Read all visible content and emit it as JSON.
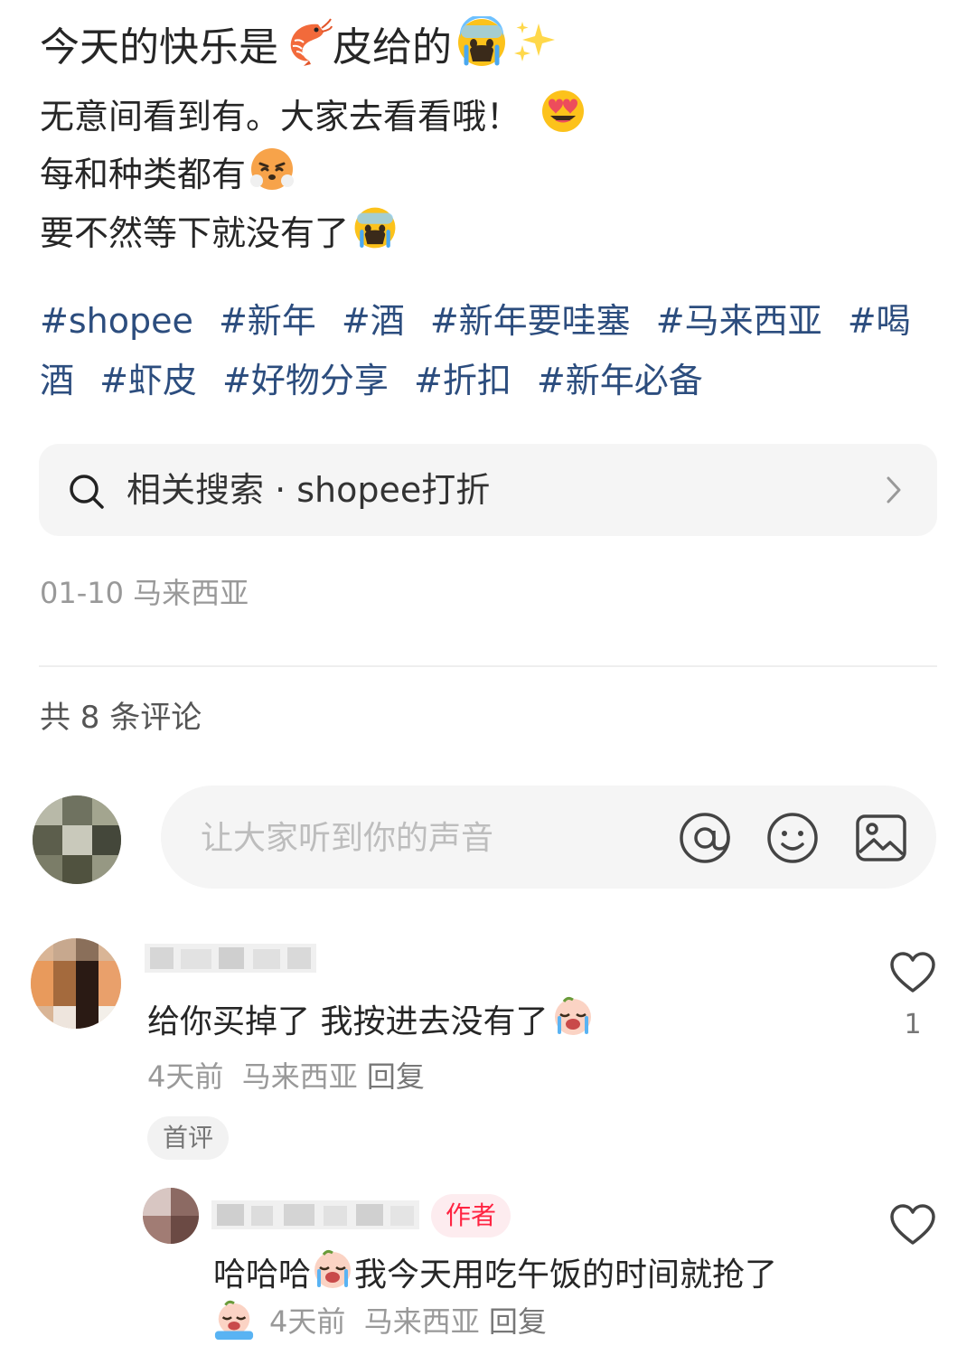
{
  "post": {
    "title": "今天的快乐是",
    "title_after_shrimp": "皮给的",
    "lines": [
      "无意间看到有。大家去看看哦！",
      "每和种类都有",
      "要不然等下就没有了"
    ],
    "tags": [
      "#shopee",
      "#新年",
      "#酒",
      "#新年要哇塞",
      "#马来西亚",
      "#喝酒",
      "#虾皮",
      "#好物分享",
      "#折扣",
      "#新年必备"
    ],
    "related_search": "相关搜索 · shopee打折",
    "date": "01-10",
    "location": "马来西亚"
  },
  "comments_section": {
    "count_label": "共 8 条评论",
    "input_placeholder": "让大家听到你的声音"
  },
  "comments": [
    {
      "text": "给你买掉了 我按进去没有了",
      "time": "4天前",
      "location": "马来西亚",
      "reply_label": "回复",
      "badge": "首评",
      "likes": "1"
    },
    {
      "badge": "作者",
      "text_prefix": "哈哈哈",
      "text": "我今天用吃午饭的时间就抢了",
      "time": "4天前",
      "location": "马来西亚",
      "reply_label": "回复"
    }
  ],
  "colors": {
    "tag": "#2c4d7e",
    "author_badge": "#ff2442",
    "muted": "#999999"
  },
  "icons": [
    "shrimp-icon",
    "crying-face-icon",
    "sparkles-icon",
    "heart-eyes-face-icon",
    "steaming-face-icon",
    "search-icon",
    "chevron-right-icon",
    "at-icon",
    "smiley-icon",
    "image-icon",
    "heart-icon"
  ]
}
